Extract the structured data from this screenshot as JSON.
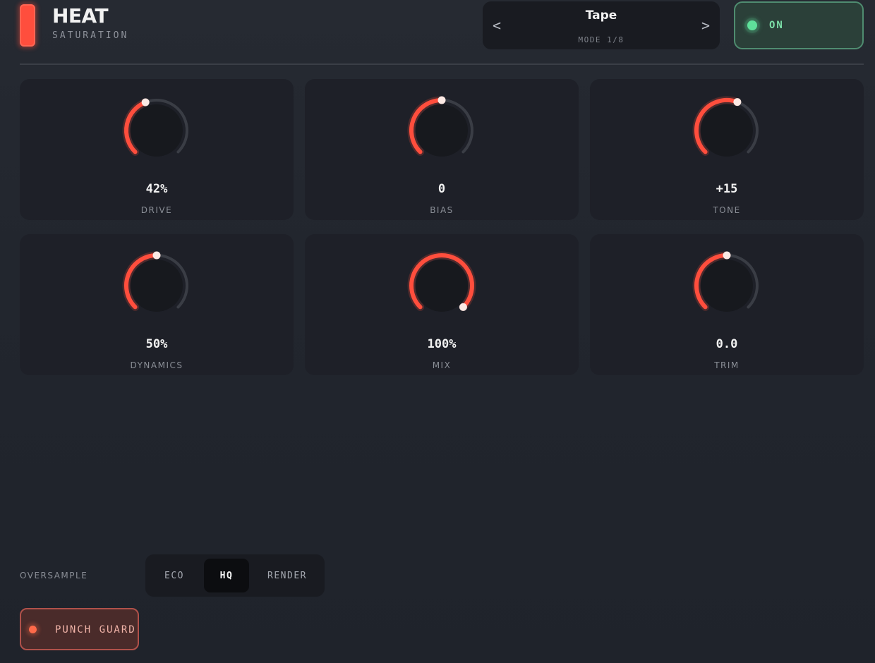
{
  "header": {
    "title": "HEAT",
    "subtitle": "SATURATION"
  },
  "mode": {
    "prev_label": "<",
    "next_label": ">",
    "name": "Tape",
    "position": "MODE 1/8"
  },
  "power": {
    "label": "ON",
    "state": "on"
  },
  "knobs": [
    {
      "label": "DRIVE",
      "value": "42%",
      "level": 0.42
    },
    {
      "label": "BIAS",
      "value": "0",
      "level": 0.5
    },
    {
      "label": "TONE",
      "value": "+15",
      "level": 0.575
    },
    {
      "label": "DYNAMICS",
      "value": "50%",
      "level": 0.5
    },
    {
      "label": "MIX",
      "value": "100%",
      "level": 1.0
    },
    {
      "label": "TRIM",
      "value": "0.0",
      "level": 0.5
    }
  ],
  "oversample": {
    "label": "OVERSAMPLE",
    "options": [
      "ECO",
      "HQ",
      "RENDER"
    ],
    "selected": "HQ"
  },
  "punch_guard": {
    "label": "PUNCH GUARD",
    "state": "on"
  },
  "colors": {
    "accent": "#ff4e3d",
    "power_on": "#5fe09a",
    "track": "#3a3d45"
  }
}
